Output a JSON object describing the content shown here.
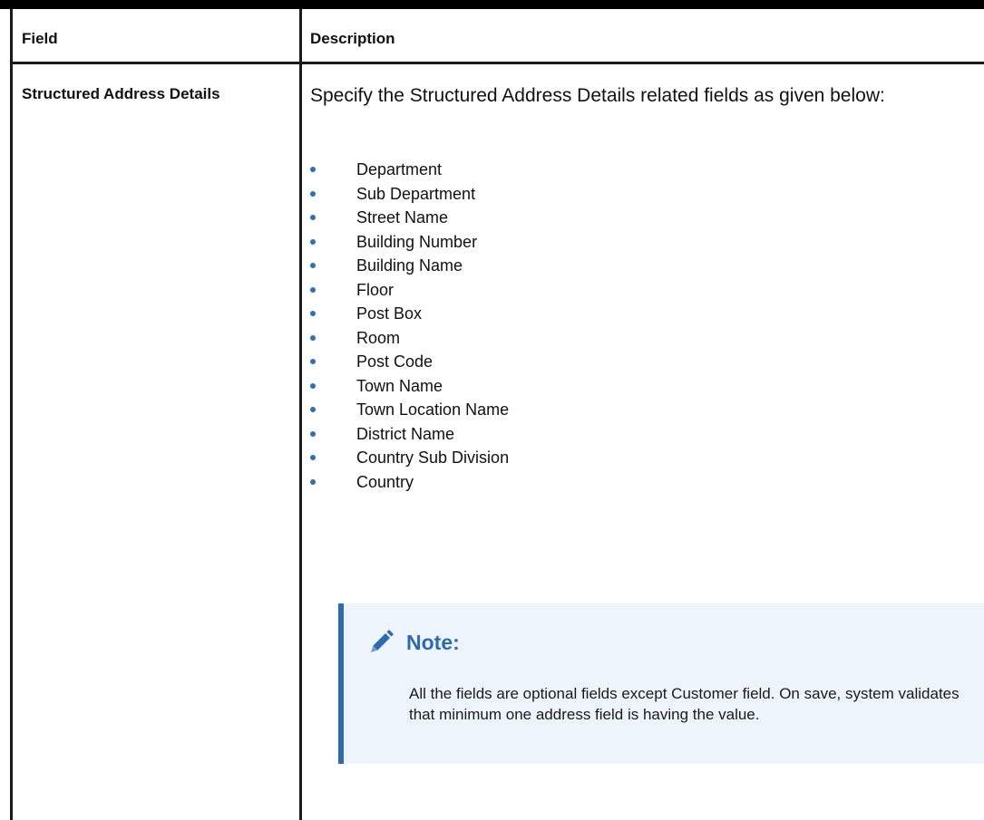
{
  "table": {
    "headers": {
      "field": "Field",
      "description": "Description"
    },
    "row": {
      "field": "Structured Address Details",
      "intro": "Specify the Structured Address Details related fields as given below:",
      "items": [
        "Department",
        "Sub Department",
        "Street Name",
        "Building Number",
        "Building Name",
        "Floor",
        "Post Box",
        "Room",
        "Post Code",
        "Town Name",
        "Town Location Name",
        "District Name",
        "Country Sub Division",
        "Country"
      ]
    }
  },
  "note": {
    "icon": "pencil-icon",
    "title": "Note:",
    "text": "All the fields are optional fields except Customer field. On save, system validates that minimum one address field is having the value."
  },
  "colors": {
    "accent": "#2c6bb3",
    "note_background": "#eef4fb",
    "bullet": "#2f6fb5"
  }
}
